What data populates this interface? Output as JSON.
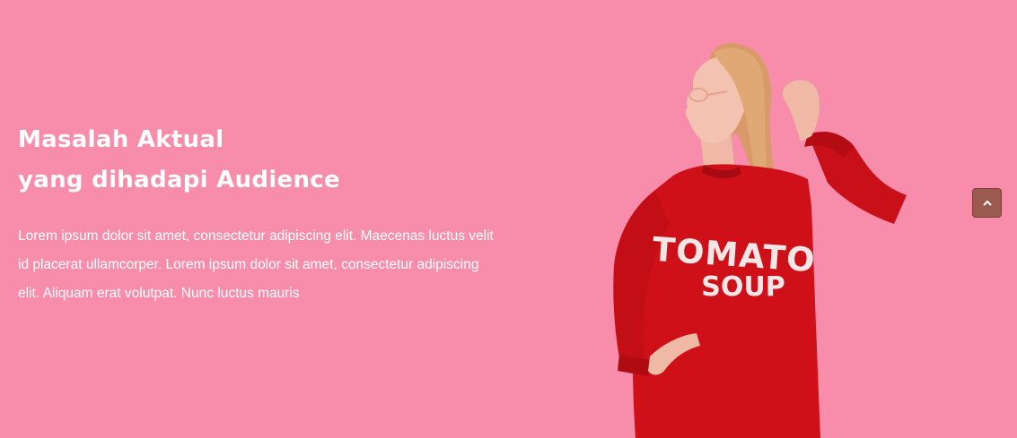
{
  "hero": {
    "heading_line1": "Masalah Aktual",
    "heading_line2": "yang dihadapi Audience",
    "body": "Lorem ipsum dolor sit amet, consectetur adipiscing elit. Maecenas luctus velit id placerat ullamcorper. Lorem ipsum dolor sit amet, consectetur adipiscing elit. Aliquam erat volutpat. Nunc luctus mauris"
  },
  "photo": {
    "shirt_line1": "TOMATO",
    "shirt_line2": "SOUP"
  },
  "colors": {
    "background": "#f78dab",
    "sweater": "#cf1019",
    "scroll_button": "#9b5a4f"
  },
  "icons": {
    "scroll_top": "chevron-up-icon"
  }
}
